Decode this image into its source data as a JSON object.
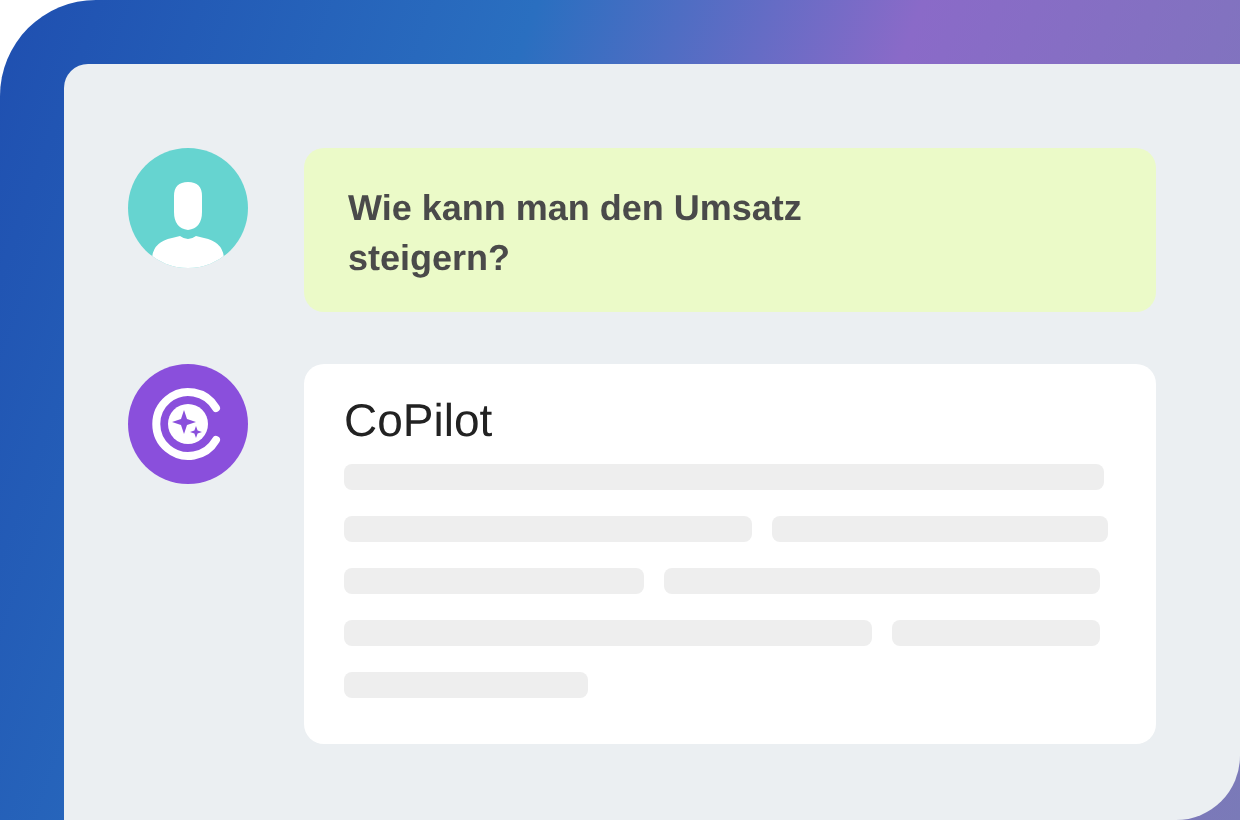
{
  "messages": [
    {
      "kind": "user",
      "text": "Wie kann man den Umsatz steigern?"
    },
    {
      "kind": "bot",
      "sender": "CoPilot",
      "loading": true
    }
  ]
}
